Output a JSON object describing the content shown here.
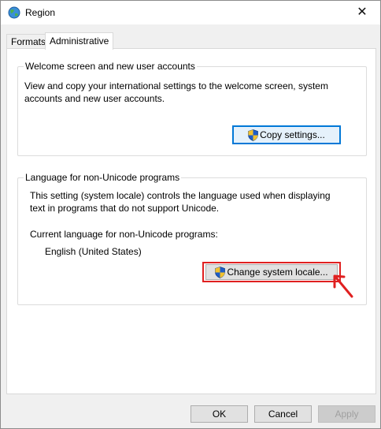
{
  "window": {
    "title": "Region",
    "close_glyph": "✕"
  },
  "tabs": [
    {
      "label": "Formats",
      "active": false
    },
    {
      "label": "Administrative",
      "active": true
    }
  ],
  "welcome_group": {
    "legend": "Welcome screen and new user accounts",
    "description_line1": "View and copy your international settings to the welcome screen, system",
    "description_line2": "accounts and new user accounts.",
    "button_label": "Copy settings..."
  },
  "locale_group": {
    "legend": "Language for non-Unicode programs",
    "description_line1": "This setting (system locale) controls the language used when displaying",
    "description_line2": "text in programs that do not support Unicode.",
    "current_label": "Current language for non-Unicode programs:",
    "current_value": "English (United States)",
    "button_label": "Change system locale..."
  },
  "footer": {
    "ok_label": "OK",
    "cancel_label": "Cancel",
    "apply_label": "Apply"
  },
  "colors": {
    "accent": "#0078d7",
    "highlight": "#e02020",
    "shield_blue": "#1e5ec8",
    "shield_yellow": "#f2c12e"
  },
  "icons": {
    "title": "globe-icon",
    "uac": "uac-shield-icon"
  }
}
